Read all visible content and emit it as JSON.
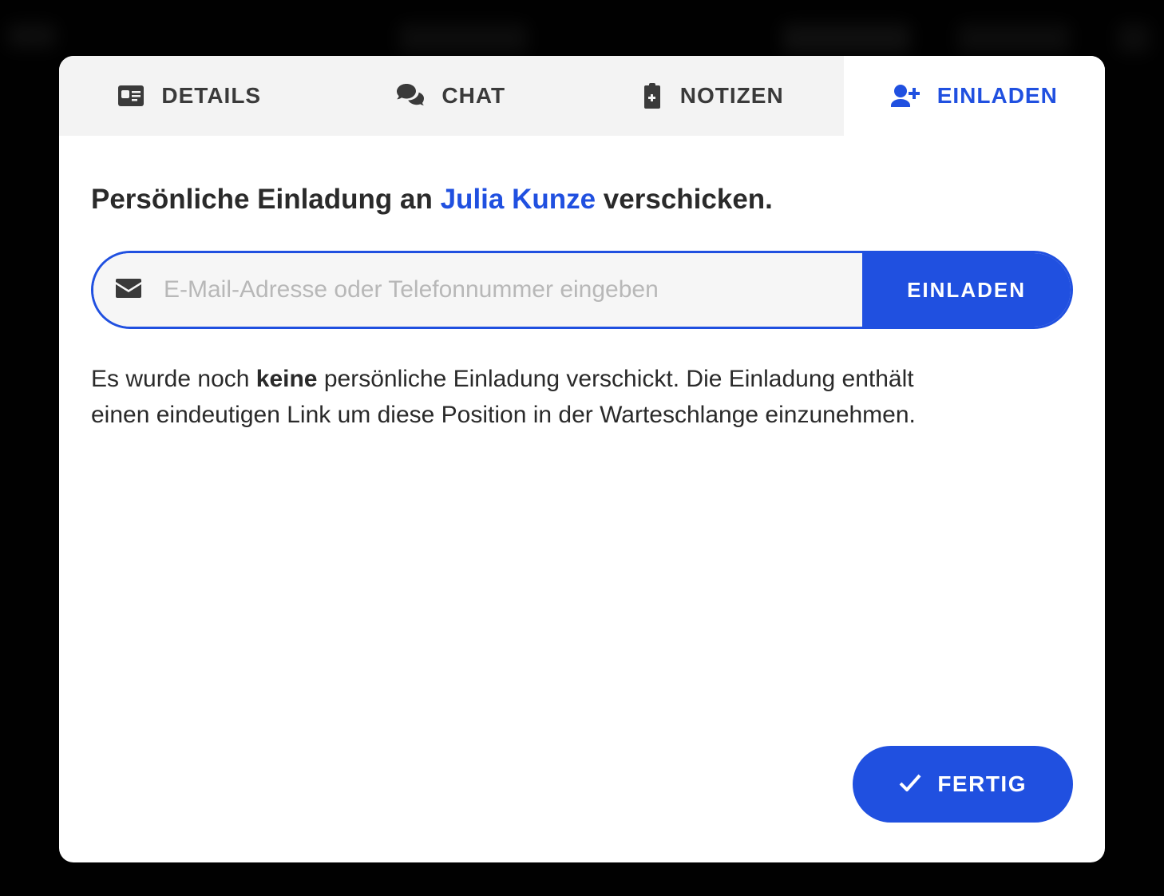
{
  "tabs": {
    "details": "DETAILS",
    "chat": "CHAT",
    "notes": "NOTIZEN",
    "invite": "EINLADEN"
  },
  "heading": {
    "prefix": "Persönliche Einladung an ",
    "name": "Julia Kunze",
    "suffix": " verschicken."
  },
  "input": {
    "placeholder": "E-Mail-Adresse oder Telefonnummer eingeben",
    "button": "EINLADEN"
  },
  "description": {
    "part1": "Es wurde noch ",
    "bold": "keine",
    "part2": " persönliche Einladung verschickt. Die Einladung enthält einen eindeutigen Link um diese Position in der Warteschlange einzunehmen."
  },
  "footer": {
    "done": "FERTIG"
  },
  "colors": {
    "accent": "#2050e0"
  }
}
